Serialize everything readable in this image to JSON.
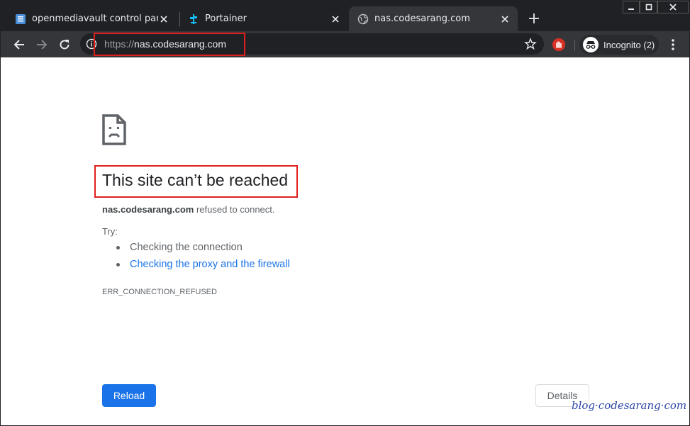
{
  "browser": {
    "tabs": [
      {
        "title": "openmediavault control panel - h",
        "favicon": "omv-icon",
        "active": false
      },
      {
        "title": "Portainer",
        "favicon": "portainer-icon",
        "active": false
      },
      {
        "title": "nas.codesarang.com",
        "favicon": "globe-icon",
        "active": true
      }
    ],
    "new_tab_icon": "plus-icon",
    "address": {
      "scheme": "https://",
      "host": "nas.codesarang.com"
    },
    "incognito_label": "Incognito (2)"
  },
  "error_page": {
    "heading": "This site can’t be reached",
    "host": "nas.codesarang.com",
    "message": " refused to connect.",
    "try_label": "Try:",
    "suggestions": [
      "Checking the connection",
      "Checking the proxy and the firewall"
    ],
    "error_code": "ERR_CONNECTION_REFUSED",
    "reload_label": "Reload",
    "details_label": "Details"
  },
  "watermark": "blog·codesarang·com",
  "colors": {
    "annotation": "#e0201e",
    "link": "#1a73e8",
    "primary_button": "#1a73e8",
    "chrome_dark": "#202124",
    "toolbar": "#35363a"
  }
}
